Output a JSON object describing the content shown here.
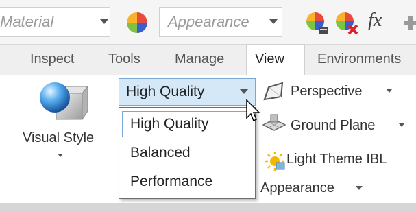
{
  "toolbar": {
    "material_combo": "Material",
    "appearance_combo": "Appearance",
    "fx_label": "fx"
  },
  "tabs": [
    {
      "label": "Inspect"
    },
    {
      "label": "Tools"
    },
    {
      "label": "Manage"
    },
    {
      "label": "View",
      "active": true
    },
    {
      "label": "Environments"
    }
  ],
  "ribbon": {
    "visual_style_label": "Visual Style",
    "quality_selected": "High Quality",
    "quality_options": [
      "High Quality",
      "Balanced",
      "Performance"
    ],
    "perspective_label": "Perspective",
    "ground_plane_label": "Ground Plane",
    "light_theme_label": "Light Theme IBL",
    "appearance_label": "Appearance"
  },
  "colors": {
    "selected_combo_bg": "#d5e8f8",
    "selected_border": "#7aa8d2"
  }
}
